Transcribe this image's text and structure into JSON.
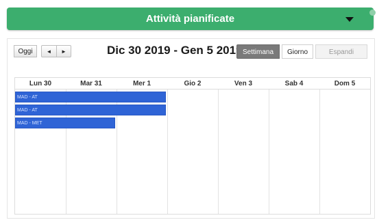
{
  "header": {
    "title": "Attività pianificate"
  },
  "toolbar": {
    "today_label": "Oggi",
    "prev_label": "◄",
    "next_label": "►",
    "range_title": "Dic 30 2019 - Gen 5 2019",
    "week_label": "Settimana",
    "day_label": "Giorno",
    "expand_label": "Espandi"
  },
  "calendar": {
    "days": [
      {
        "label": "Lun 30"
      },
      {
        "label": "Mar 31"
      },
      {
        "label": "Mer 1"
      },
      {
        "label": "Gio 2"
      },
      {
        "label": "Ven 3"
      },
      {
        "label": "Sab 4"
      },
      {
        "label": "Dom 5"
      }
    ],
    "events": [
      {
        "label": "MAD - AT",
        "start_day": 0,
        "span_days": 3
      },
      {
        "label": "MAD - AT",
        "start_day": 0,
        "span_days": 3
      },
      {
        "label": "MAD - MET",
        "start_day": 0,
        "span_days": 2
      }
    ]
  },
  "colors": {
    "header_bg": "#3cae6e",
    "event_bg": "#2f64d6",
    "active_button_bg": "#7a7a7a"
  }
}
